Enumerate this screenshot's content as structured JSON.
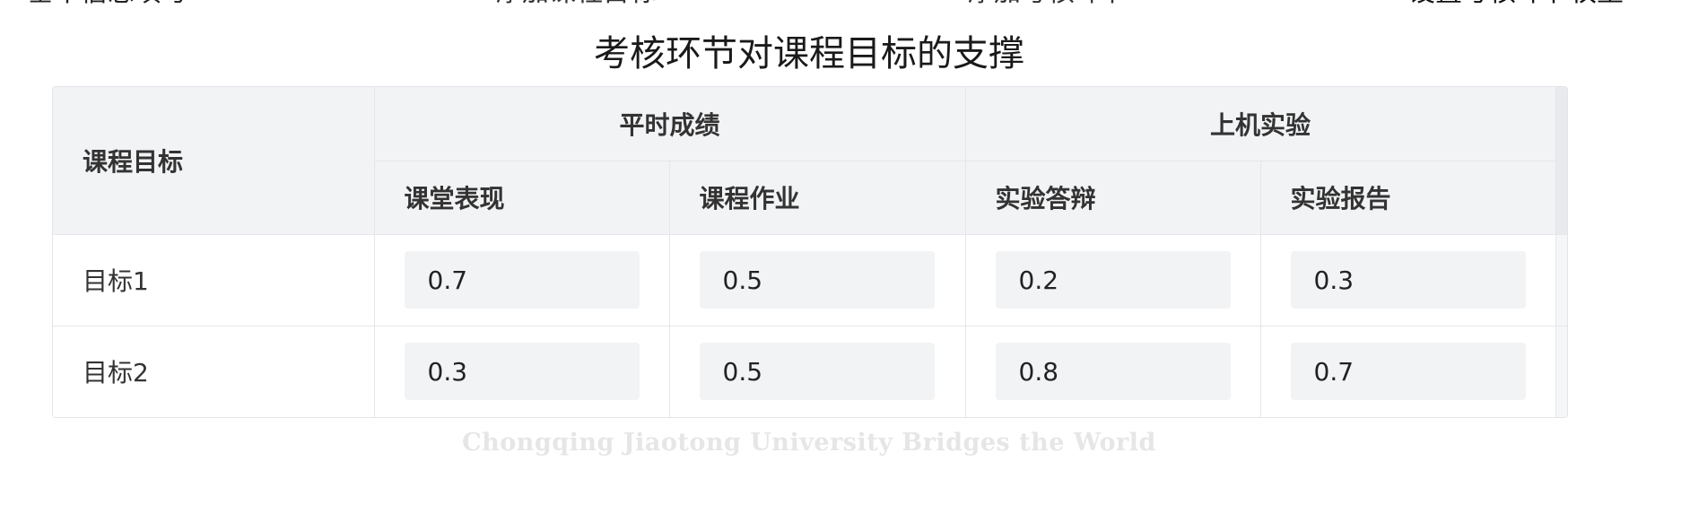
{
  "steps": [
    {
      "label": "基本信息填写"
    },
    {
      "label": "添加课程目标"
    },
    {
      "label": "添加考核环节"
    },
    {
      "label": "设置考核环节权重"
    }
  ],
  "title": "考核环节对课程目标的支撑",
  "table": {
    "goal_header": "课程目标",
    "groups": [
      {
        "label": "平时成绩",
        "items": [
          "课堂表现",
          "课程作业"
        ]
      },
      {
        "label": "上机实验",
        "items": [
          "实验答辩",
          "实验报告"
        ]
      }
    ],
    "rows": [
      {
        "goal": "目标1",
        "values": [
          "0.7",
          "0.5",
          "0.2",
          "0.3"
        ]
      },
      {
        "goal": "目标2",
        "values": [
          "0.3",
          "0.5",
          "0.8",
          "0.7"
        ]
      }
    ]
  },
  "watermark": "Chongqing Jiaotong University Bridges the World"
}
